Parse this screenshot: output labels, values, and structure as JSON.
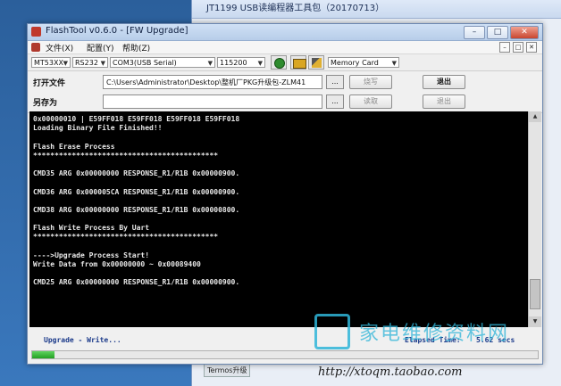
{
  "background": {
    "window_title": "JT1199 USB读编程器工具包（20170713）",
    "taskbar_label": "Termos升级"
  },
  "window": {
    "title": "FlashTool v0.6.0 - [FW Upgrade]",
    "controls": {
      "minimize": "–",
      "maximize": "□",
      "close": "✕"
    }
  },
  "menu": {
    "items": [
      "文件(X)",
      "配置(Y)",
      "帮助(Z)"
    ],
    "mdi_controls": [
      "–",
      "□",
      "✕"
    ]
  },
  "toolbar": {
    "chip": "MT53XX",
    "interface": "RS232",
    "port": "COM3(USB Serial)",
    "baud": "115200",
    "storage": "Memory Card"
  },
  "file_panel": {
    "open_label": "打开文件",
    "open_path": "C:\\Users\\Administrator\\Desktop\\整机厂PKG升级包-ZLM41",
    "saveas_label": "另存为",
    "saveas_path": "",
    "browse_label": "...",
    "burn_label": "烧写",
    "exit_label": "退出",
    "read_label": "读取",
    "exit2_label": "退出"
  },
  "console": {
    "lines": [
      "0x00000010 | E59FF018 E59FF018 E59FF018 E59FF018",
      "Loading Binary File Finished!!",
      "",
      "Flash Erase Process",
      "*******************************************",
      "",
      "CMD35 ARG 0x00000000 RESPONSE_R1/R1B 0x00000900.",
      "",
      "CMD36 ARG 0x000005CA RESPONSE_R1/R1B 0x00000900.",
      "",
      "CMD38 ARG 0x00000000 RESPONSE_R1/R1B 0x00000800.",
      "",
      "Flash Write Process By Uart",
      "*******************************************",
      "",
      "---->Upgrade Process Start!",
      "Write Data from 0x00000000 ~ 0x00089400",
      "",
      "CMD25 ARG 0x00000000 RESPONSE_R1/R1B 0x00000900."
    ]
  },
  "status": {
    "text": "Upgrade - Write...",
    "elapsed_label": "Elapsed Time:",
    "elapsed_value": "5.62 secs",
    "progress": 0.045
  },
  "watermark": {
    "text": "家电维修资料网",
    "url": "http://xtoqm.taobao.com"
  },
  "colors": {
    "console_bg": "#000000",
    "console_fg": "#e8e8e8",
    "status_fg": "#1b3a8a",
    "progress": "#23a023",
    "watermark": "#2fb5d8"
  }
}
